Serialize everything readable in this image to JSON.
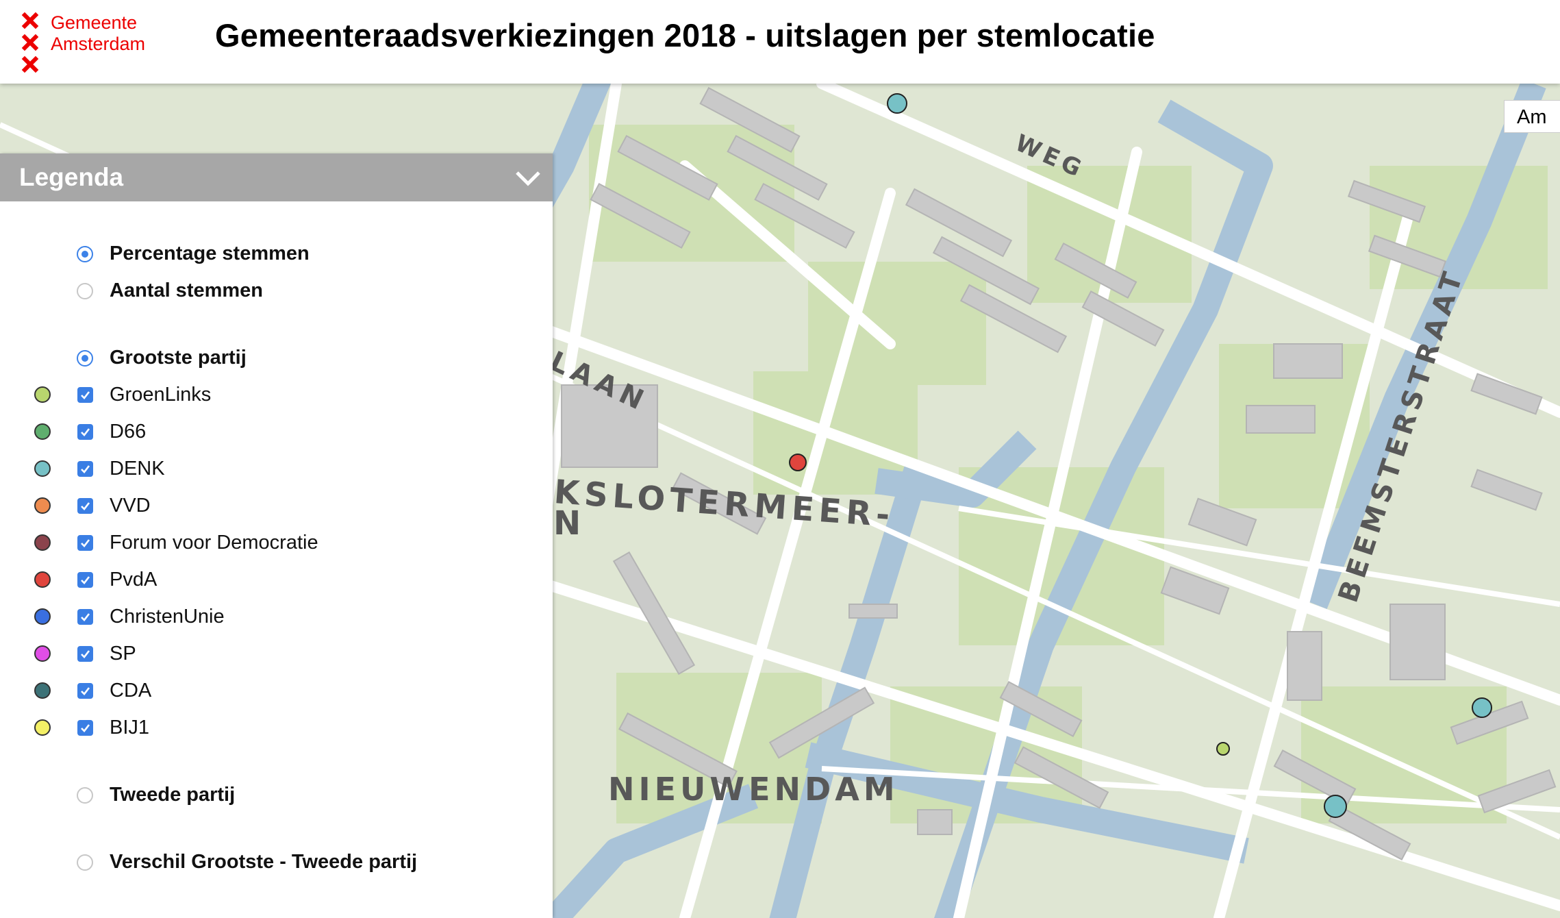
{
  "header": {
    "logo_line1": "Gemeente",
    "logo_line2": "Amsterdam",
    "title": "Gemeenteraadsverkiezingen 2018 - uitslagen per stemlocatie"
  },
  "colors": {
    "brand_red": "#ec0000",
    "legend_header": "#a7a7a7",
    "accent_blue": "#3a7ee4"
  },
  "map": {
    "search_button": "Am",
    "labels": {
      "weg": "WEG",
      "laan": "LAAN",
      "slotermeer": "KSLOTERMEER-",
      "slotermeer_n": "N",
      "beemsterstraat": "BEEMSTERSTRAAT",
      "nieuwendam": "NIEUWENDAM"
    },
    "markers": [
      {
        "party": "DENK",
        "color": "#77c1c6"
      },
      {
        "party": "PvdA",
        "color": "#e0453d"
      },
      {
        "party": "GroenLinks",
        "color": "#b9d66e"
      },
      {
        "party": "DENK",
        "color": "#77c1c6"
      },
      {
        "party": "DENK",
        "color": "#77c1c6"
      }
    ]
  },
  "legend": {
    "title": "Legenda",
    "modes": [
      {
        "label": "Percentage stemmen",
        "selected": true
      },
      {
        "label": "Aantal stemmen",
        "selected": false
      }
    ],
    "views": {
      "grootste": {
        "label": "Grootste partij",
        "selected": true
      },
      "tweede": {
        "label": "Tweede partij",
        "selected": false
      },
      "verschil": {
        "label": "Verschil Grootste - Tweede partij",
        "selected": false
      }
    },
    "parties": [
      {
        "name": "GroenLinks",
        "color": "#b9d66e",
        "checked": true
      },
      {
        "name": "D66",
        "color": "#5fae6e",
        "checked": true
      },
      {
        "name": "DENK",
        "color": "#77c1c6",
        "checked": true
      },
      {
        "name": "VVD",
        "color": "#ee8c4f",
        "checked": true
      },
      {
        "name": "Forum voor Democratie",
        "color": "#8b434c",
        "checked": true
      },
      {
        "name": "PvdA",
        "color": "#e0453d",
        "checked": true
      },
      {
        "name": "ChristenUnie",
        "color": "#3a6fe0",
        "checked": true
      },
      {
        "name": "SP",
        "color": "#e04ee6",
        "checked": true
      },
      {
        "name": "CDA",
        "color": "#3d7277",
        "checked": true
      },
      {
        "name": "BIJ1",
        "color": "#f4f066",
        "checked": true
      }
    ]
  }
}
